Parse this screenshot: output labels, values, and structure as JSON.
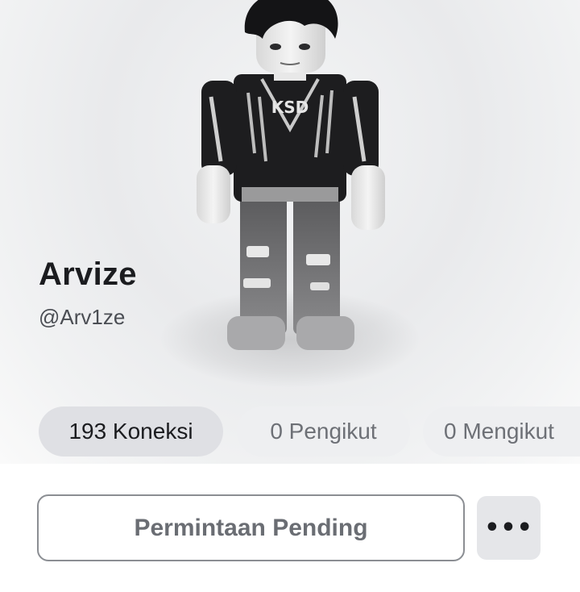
{
  "profile": {
    "display_name": "Arvize",
    "username": "@Arv1ze"
  },
  "stats": [
    {
      "label": "193 Koneksi",
      "active": true
    },
    {
      "label": "0 Pengikut",
      "active": false
    },
    {
      "label": "0 Mengikut",
      "active": false
    }
  ],
  "actions": {
    "pending_label": "Permintaan Pending",
    "more_icon": "more-horizontal-icon",
    "more_glyph": "•••"
  },
  "colors": {
    "text_primary": "#1b1c1f",
    "text_secondary": "#4b4e54",
    "pill_active": "#dfe0e4",
    "pill_inactive": "#eeeff1"
  }
}
